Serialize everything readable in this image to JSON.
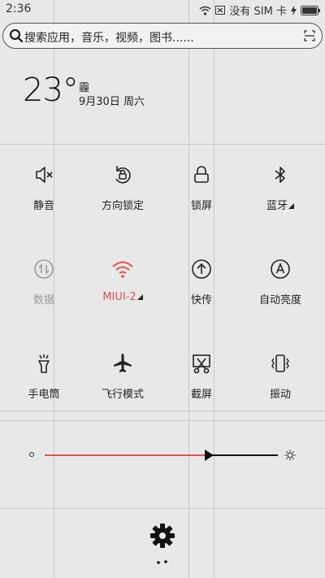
{
  "status": {
    "time": "2:36",
    "no_sim": "没有 SIM 卡",
    "icons": [
      "wifi-icon",
      "sim-slot-icon",
      "charging-icon",
      "battery-icon"
    ]
  },
  "search": {
    "placeholder": "搜索应用，音乐，视频，图书......"
  },
  "weather": {
    "temp": "23°",
    "condition": "霾",
    "date": "9月30日 周六"
  },
  "toggles": [
    {
      "label": "静音",
      "icon": "mute-icon",
      "state": "off"
    },
    {
      "label": "方向锁定",
      "icon": "rotation-lock-icon",
      "state": "off"
    },
    {
      "label": "锁屏",
      "icon": "lock-screen-icon",
      "state": "off"
    },
    {
      "label": "蓝牙",
      "icon": "bluetooth-icon",
      "state": "off"
    },
    {
      "label": "数据",
      "icon": "data-icon",
      "state": "disabled"
    },
    {
      "label": "MIUI-2",
      "icon": "wifi-icon",
      "state": "on"
    },
    {
      "label": "快传",
      "icon": "quick-transfer-icon",
      "state": "off"
    },
    {
      "label": "自动亮度",
      "icon": "auto-brightness-icon",
      "state": "off"
    },
    {
      "label": "手电筒",
      "icon": "flashlight-icon",
      "state": "off"
    },
    {
      "label": "飞行模式",
      "icon": "airplane-icon",
      "state": "off"
    },
    {
      "label": "截屏",
      "icon": "screenshot-icon",
      "state": "off"
    },
    {
      "label": "振动",
      "icon": "vibrate-icon",
      "state": "off"
    }
  ],
  "brightness": {
    "level": 0.7
  },
  "colors": {
    "accent": "#e0524f",
    "background": "#e8e8e8",
    "disabled": "#9a9a9a"
  }
}
